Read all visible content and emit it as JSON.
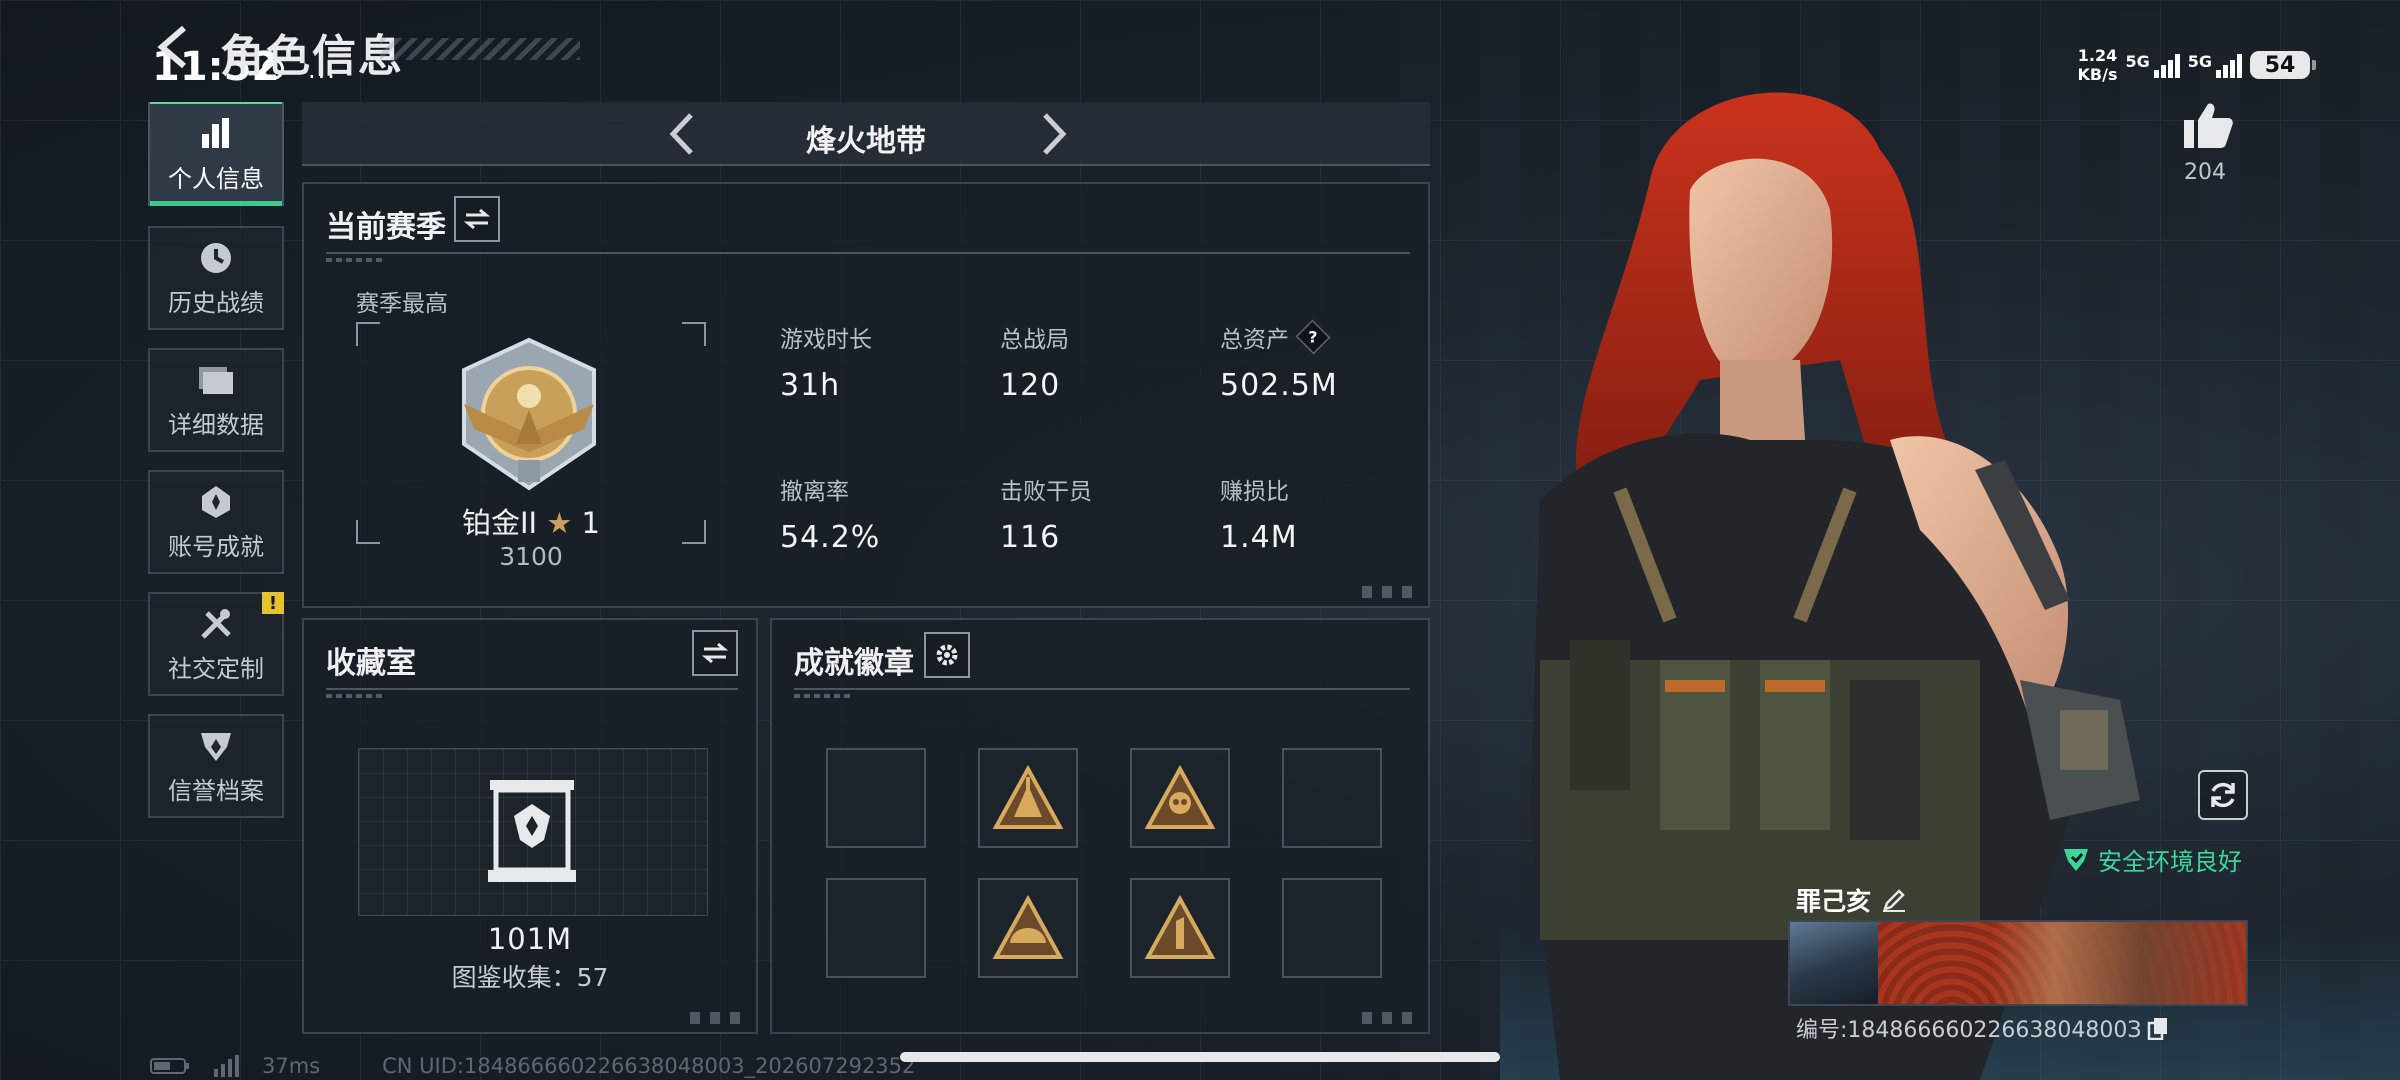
{
  "status_bar": {
    "time": "11:52",
    "net_speed_value": "1.24",
    "net_speed_unit": "KB/s",
    "signal1_label": "5G",
    "signal2_label": "5G",
    "battery": "54"
  },
  "header": {
    "title": "角色信息"
  },
  "sidebar": {
    "items": [
      {
        "label": "个人信息",
        "icon": "bar-chart-icon",
        "active": true
      },
      {
        "label": "历史战绩",
        "icon": "history-clock-icon"
      },
      {
        "label": "详细数据",
        "icon": "folder-icon"
      },
      {
        "label": "账号成就",
        "icon": "achievement-icon"
      },
      {
        "label": "社交定制",
        "icon": "tools-icon",
        "badge": "!"
      },
      {
        "label": "信誉档案",
        "icon": "credit-icon"
      }
    ]
  },
  "mode": {
    "title": "烽火地带"
  },
  "season": {
    "title": "当前赛季",
    "best_label": "赛季最高",
    "rank_name": "铂金II",
    "rank_stars": "1",
    "rank_points": "3100",
    "stats": [
      {
        "label": "游戏时长",
        "value": "31h"
      },
      {
        "label": "总战局",
        "value": "120"
      },
      {
        "label": "总资产",
        "value": "502.5M",
        "help": "?"
      },
      {
        "label": "撤离率",
        "value": "54.2%"
      },
      {
        "label": "击败干员",
        "value": "116"
      },
      {
        "label": "赚损比",
        "value": "1.4M"
      }
    ]
  },
  "collection": {
    "title": "收藏室",
    "value": "101M",
    "count_text": "图鉴收集：57"
  },
  "achievements": {
    "title": "成就徽章",
    "slots": [
      "empty",
      "badge-camp",
      "badge-skull",
      "empty",
      "empty",
      "badge-helmet",
      "badge-number-one",
      "empty"
    ]
  },
  "profile": {
    "likes": "204",
    "safe_status": "安全环境良好",
    "player_name": "罪己亥",
    "player_id": "编号:18486666022663804800З"
  },
  "footer": {
    "ping": "37ms",
    "uid": "CN UID:184866660226638048003_202607292352"
  },
  "colors": {
    "accent_green": "#3fc98d",
    "safe_green": "#3fd69a",
    "warning_yellow": "#e6c230",
    "gold": "#c9a05a"
  }
}
